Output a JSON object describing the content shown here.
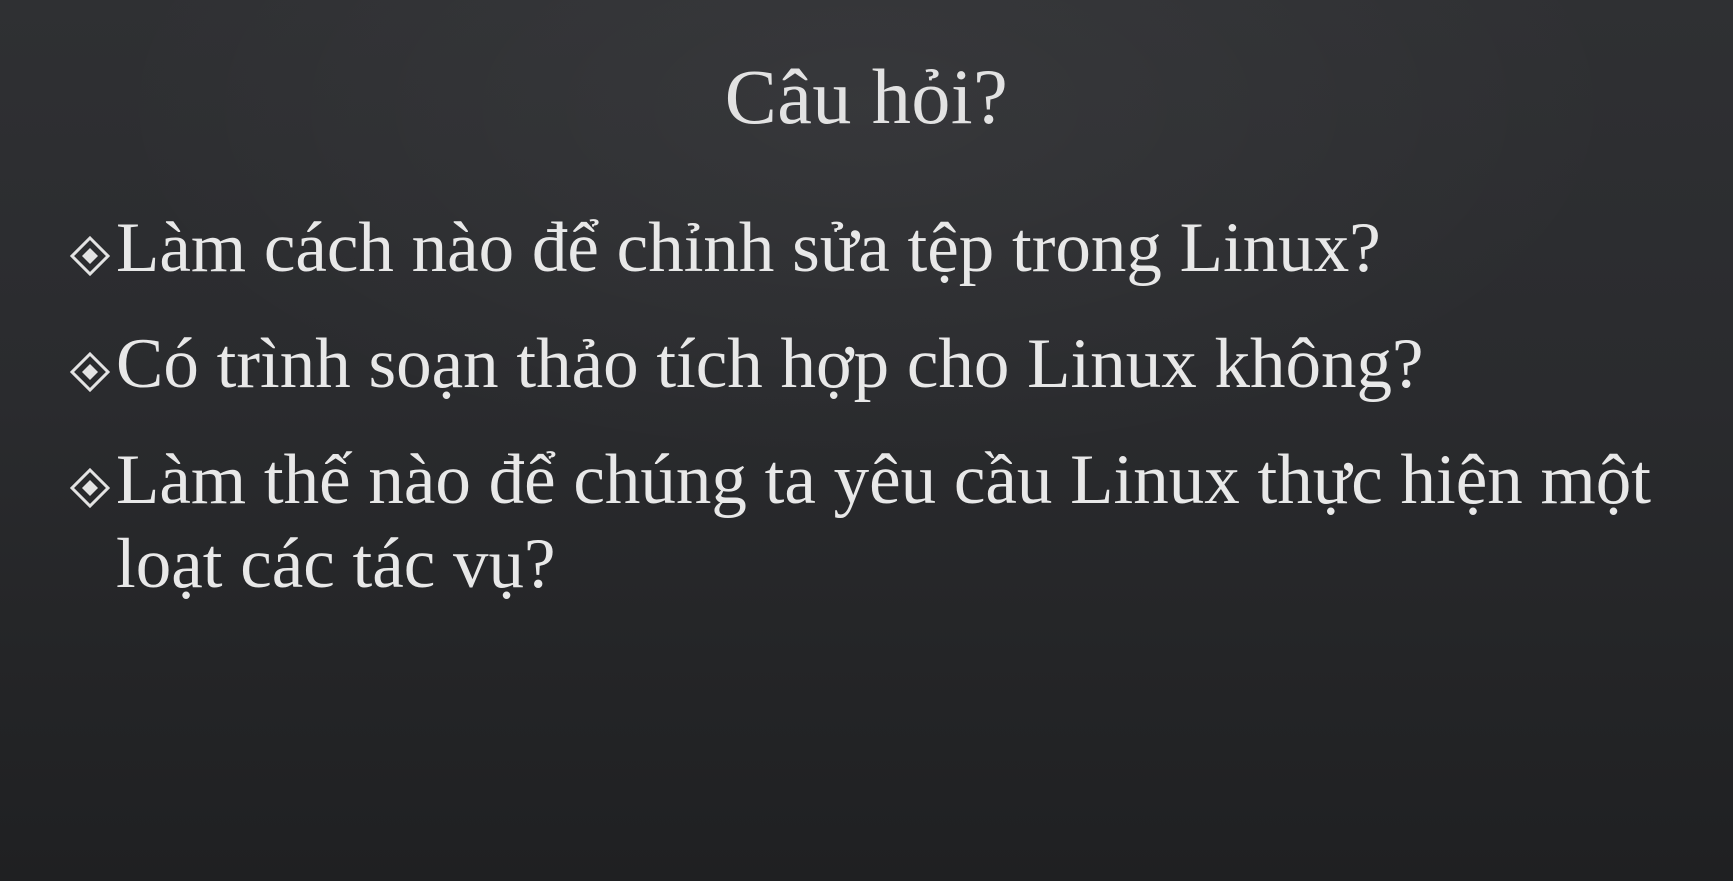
{
  "slide": {
    "title": "Câu hỏi?",
    "bullets": [
      {
        "text": "Làm cách nào để chỉnh sửa tệp trong Linux?"
      },
      {
        "text": "Có trình soạn thảo tích hợp cho Linux không?"
      },
      {
        "text": "Làm thế nào để chúng ta yêu cầu Linux thực hiện một loạt các tác vụ?"
      }
    ],
    "bullet_icon": "diamond-bullet-icon",
    "colors": {
      "background": "#2a2b2e",
      "text": "#e8e8e8"
    }
  }
}
